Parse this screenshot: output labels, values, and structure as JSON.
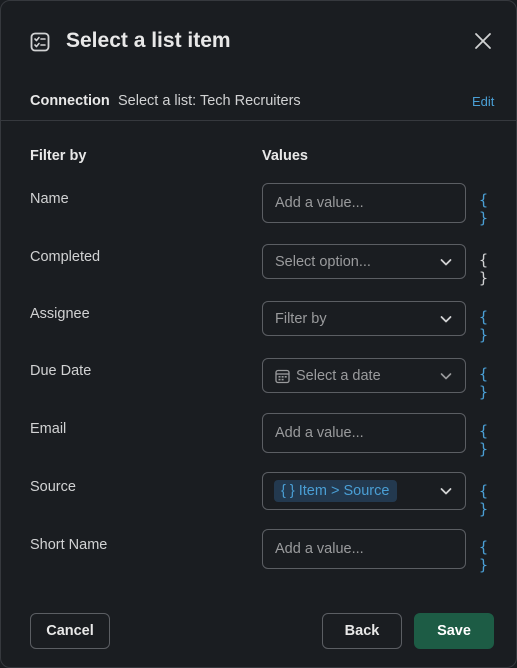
{
  "header": {
    "title": "Select a list item",
    "title_icon": "list-check-icon",
    "close_icon": "close-icon"
  },
  "connection": {
    "label": "Connection",
    "value": "Select a list: Tech Recruiters",
    "edit_label": "Edit"
  },
  "columns": {
    "filter_by": "Filter by",
    "values": "Values"
  },
  "rows": {
    "name": {
      "label": "Name",
      "placeholder": "Add a value..."
    },
    "completed": {
      "label": "Completed",
      "placeholder": "Select option..."
    },
    "assignee": {
      "label": "Assignee",
      "placeholder": "Filter by"
    },
    "due_date": {
      "label": "Due Date",
      "placeholder": "Select a date"
    },
    "email": {
      "label": "Email",
      "placeholder": "Add a value..."
    },
    "source": {
      "label": "Source",
      "token": "{ } Item > Source"
    },
    "short_name": {
      "label": "Short Name",
      "placeholder": "Add a value..."
    }
  },
  "braces_symbol": "{ }",
  "footer": {
    "cancel": "Cancel",
    "back": "Back",
    "save": "Save"
  },
  "colors": {
    "background": "#1a1d21",
    "accent_blue": "#4a9fd5",
    "save_green": "#1d5c45"
  }
}
